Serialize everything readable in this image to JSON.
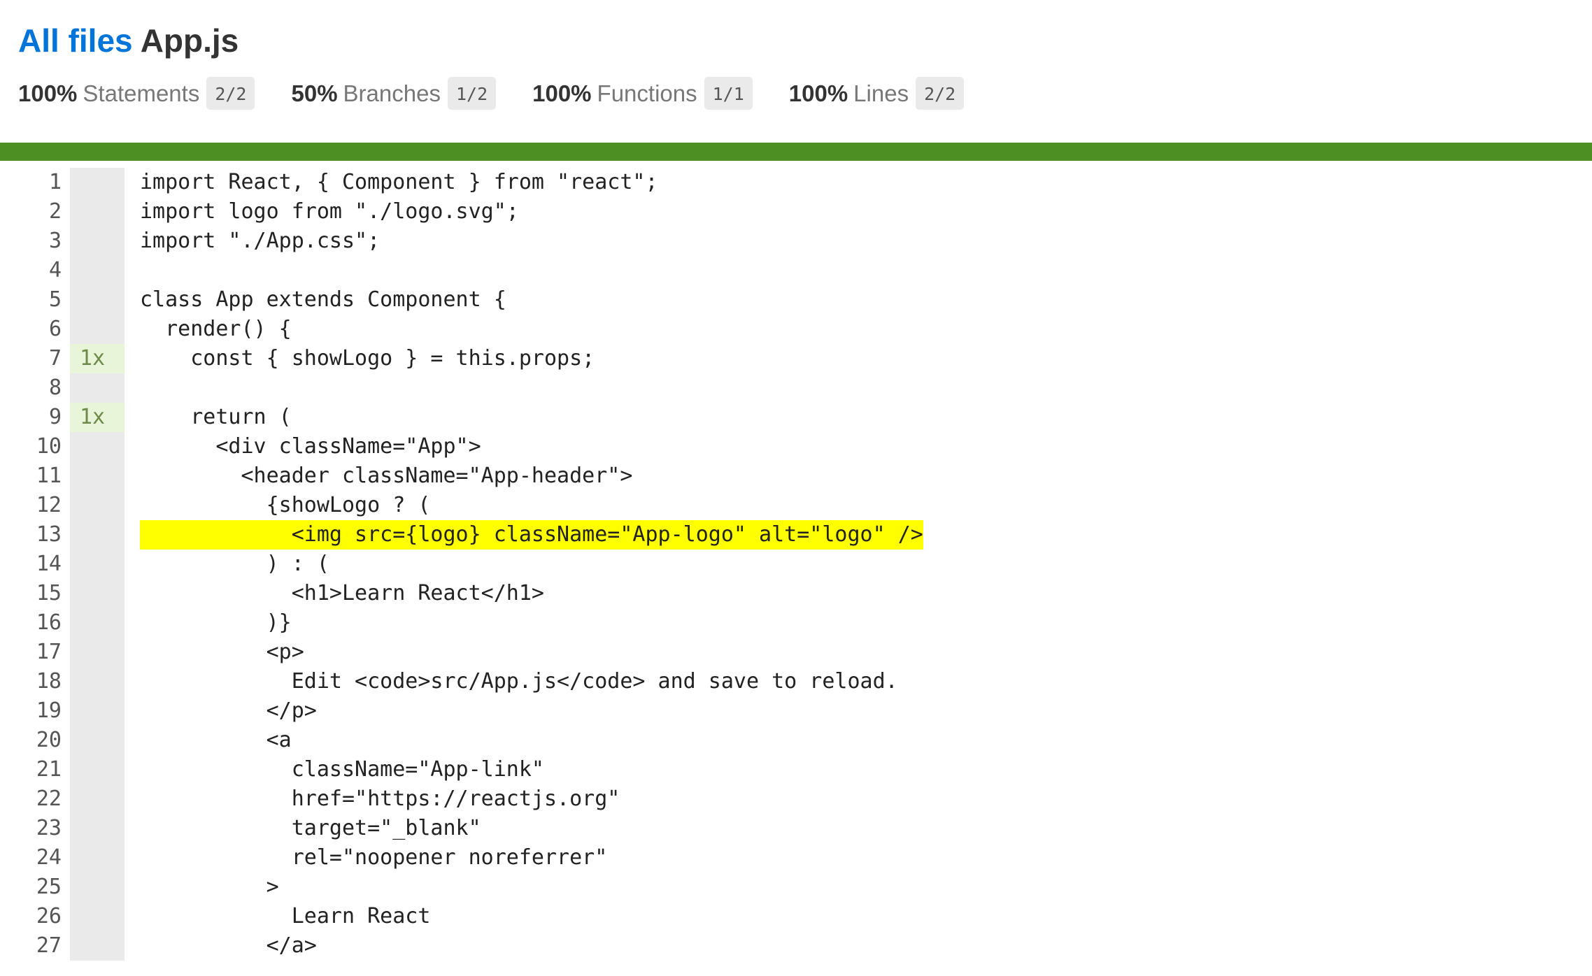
{
  "header": {
    "breadcrumb": "All files",
    "filename": "App.js"
  },
  "metrics": [
    {
      "pct": "100%",
      "label": "Statements",
      "fraction": "2/2"
    },
    {
      "pct": "50%",
      "label": "Branches",
      "fraction": "1/2"
    },
    {
      "pct": "100%",
      "label": "Functions",
      "fraction": "1/1"
    },
    {
      "pct": "100%",
      "label": "Lines",
      "fraction": "2/2"
    }
  ],
  "colors": {
    "link_blue": "#0074d9",
    "coverage_bar_green": "#4d8f22",
    "uncovered_highlight": "#ffff00",
    "hit_count_bg": "#e8f5d9"
  },
  "code_lines": [
    {
      "n": "1",
      "hits": "",
      "text": "import React, { Component } from \"react\";"
    },
    {
      "n": "2",
      "hits": "",
      "text": "import logo from \"./logo.svg\";"
    },
    {
      "n": "3",
      "hits": "",
      "text": "import \"./App.css\";"
    },
    {
      "n": "4",
      "hits": "",
      "text": ""
    },
    {
      "n": "5",
      "hits": "",
      "text": "class App extends Component {"
    },
    {
      "n": "6",
      "hits": "",
      "text": "  render() {"
    },
    {
      "n": "7",
      "hits": "1x",
      "text": "    const { showLogo } = this.props;"
    },
    {
      "n": "8",
      "hits": "",
      "text": ""
    },
    {
      "n": "9",
      "hits": "1x",
      "text": "    return ("
    },
    {
      "n": "10",
      "hits": "",
      "text": "      <div className=\"App\">"
    },
    {
      "n": "11",
      "hits": "",
      "text": "        <header className=\"App-header\">"
    },
    {
      "n": "12",
      "hits": "",
      "text": "          {showLogo ? ("
    },
    {
      "n": "13",
      "hits": "",
      "text": "            <img src={logo} className=\"App-logo\" alt=\"logo\" />",
      "uncovered": true
    },
    {
      "n": "14",
      "hits": "",
      "text": "          ) : ("
    },
    {
      "n": "15",
      "hits": "",
      "text": "            <h1>Learn React</h1>"
    },
    {
      "n": "16",
      "hits": "",
      "text": "          )}"
    },
    {
      "n": "17",
      "hits": "",
      "text": "          <p>"
    },
    {
      "n": "18",
      "hits": "",
      "text": "            Edit <code>src/App.js</code> and save to reload."
    },
    {
      "n": "19",
      "hits": "",
      "text": "          </p>"
    },
    {
      "n": "20",
      "hits": "",
      "text": "          <a"
    },
    {
      "n": "21",
      "hits": "",
      "text": "            className=\"App-link\""
    },
    {
      "n": "22",
      "hits": "",
      "text": "            href=\"https://reactjs.org\""
    },
    {
      "n": "23",
      "hits": "",
      "text": "            target=\"_blank\""
    },
    {
      "n": "24",
      "hits": "",
      "text": "            rel=\"noopener noreferrer\""
    },
    {
      "n": "25",
      "hits": "",
      "text": "          >"
    },
    {
      "n": "26",
      "hits": "",
      "text": "            Learn React"
    },
    {
      "n": "27",
      "hits": "",
      "text": "          </a>"
    }
  ]
}
